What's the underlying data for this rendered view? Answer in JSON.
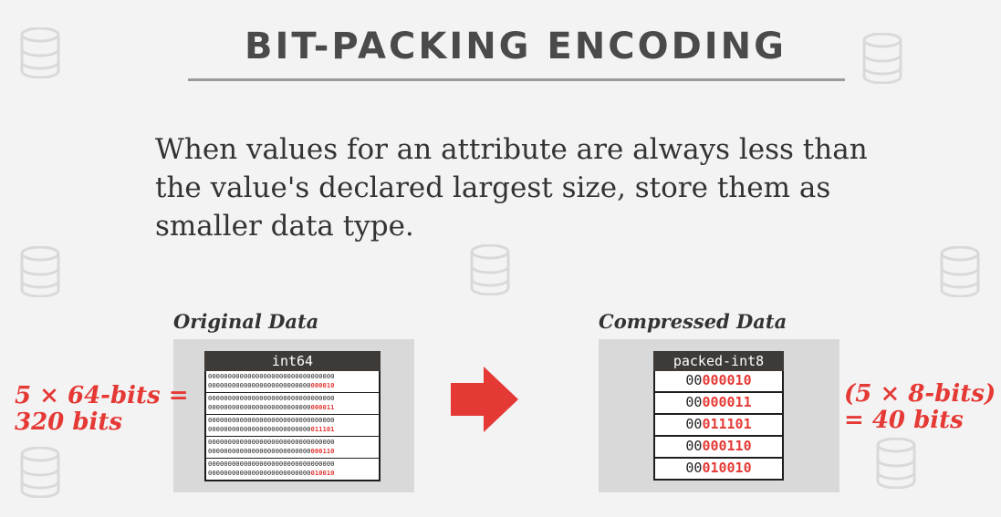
{
  "slide": {
    "title": "BIT-PACKING ENCODING",
    "body": "When values for an attribute are always less than the value's declared largest size, store them as smaller data type."
  },
  "original": {
    "label": "Original Data",
    "column_header": "int64",
    "rows": [
      {
        "line1": "00000000000000000000000000000000",
        "line2_prefix": "00000000000000000000000000",
        "line2_suffix": "000010"
      },
      {
        "line1": "00000000000000000000000000000000",
        "line2_prefix": "00000000000000000000000000",
        "line2_suffix": "000011"
      },
      {
        "line1": "00000000000000000000000000000000",
        "line2_prefix": "00000000000000000000000000",
        "line2_suffix": "011101"
      },
      {
        "line1": "00000000000000000000000000000000",
        "line2_prefix": "00000000000000000000000000",
        "line2_suffix": "000110"
      },
      {
        "line1": "00000000000000000000000000000000",
        "line2_prefix": "00000000000000000000000000",
        "line2_suffix": "010010"
      }
    ],
    "size_line1": "5 × 64-bits =",
    "size_line2": "320 bits"
  },
  "compressed": {
    "label": "Compressed Data",
    "column_header": "packed-int8",
    "rows": [
      {
        "prefix": "00",
        "suffix": "000010"
      },
      {
        "prefix": "00",
        "suffix": "000011"
      },
      {
        "prefix": "00",
        "suffix": "011101"
      },
      {
        "prefix": "00",
        "suffix": "000110"
      },
      {
        "prefix": "00",
        "suffix": "010010"
      }
    ],
    "size_line1": "(5 × 8-bits)",
    "size_line2": "= 40 bits"
  },
  "icons": {
    "background": "database-icon",
    "arrow": "right-arrow-icon"
  },
  "colors": {
    "accent_red": "#e53935",
    "table_header": "#3d3a37",
    "panel": "#d9d9d9",
    "title": "#4a4a4a"
  }
}
